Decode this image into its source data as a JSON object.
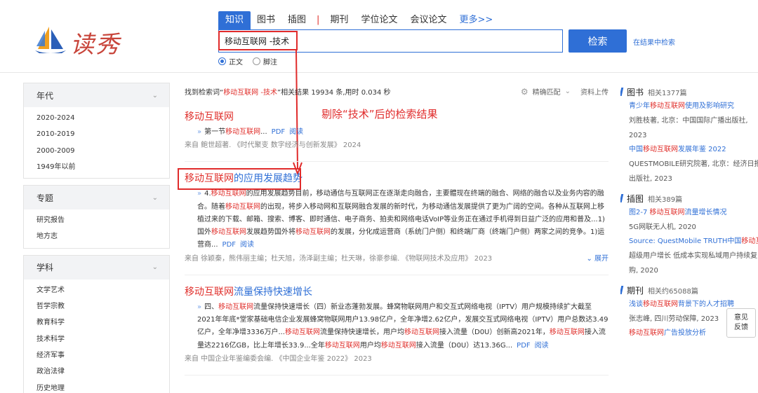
{
  "header": {
    "logo_text": "读秀",
    "tabs": [
      "知识",
      "图书",
      "插图",
      "|",
      "期刊",
      "学位论文",
      "会议论文",
      "更多>>"
    ],
    "search_value": "移动互联网 -技术",
    "search_button": "检索",
    "search_within": "在结果中检索",
    "radio_options": [
      "正文",
      "脚注"
    ]
  },
  "annotation": "剔除“技术”后的检索结果",
  "left": {
    "facets": [
      {
        "title": "年代",
        "items": [
          "2020-2024",
          "2010-2019",
          "2000-2009",
          "1949年以前"
        ]
      },
      {
        "title": "专题",
        "items": [
          "研究报告",
          "地方志"
        ]
      },
      {
        "title": "学科",
        "items": [
          "文学艺术",
          "哲学宗教",
          "教育科学",
          "技术科学",
          "经济军事",
          "政治法律",
          "历史地理"
        ]
      }
    ]
  },
  "main": {
    "summary_pre": "找到检索词“",
    "summary_term": "移动互联网 -技术",
    "summary_post": "”相关结果 19934 条,用时 0.034 秒",
    "precise_match": "精确匹配",
    "upload": "资料上传",
    "results": [
      {
        "title_hl": "移动互联网",
        "title_rest": "",
        "snippet_parts": [
          {
            "t": "第一节",
            "hl": false
          },
          {
            "t": "移动互联网",
            "hl": true
          },
          {
            "t": "...",
            "hl": false
          }
        ],
        "pdf": "PDF",
        "read": "阅读",
        "source": "来自 鲍世超著. 《时代聚变 数字经济与创新发展》 2024",
        "expand": ""
      },
      {
        "title_hl": "移动互联网",
        "title_rest": "的应用发展趋势",
        "snippet_parts": [
          {
            "t": "4.",
            "hl": false
          },
          {
            "t": "移动互联网",
            "hl": true
          },
          {
            "t": "的应用发展趋势目前，移动通信与互联网正在逐渐走向融合，主要體现在终端的融合、网络的融合以及业务内容的融合。随着",
            "hl": false
          },
          {
            "t": "移动互联网",
            "hl": true
          },
          {
            "t": "的出现，将步入移动网和互联网融合发展的新时代，为移动通信发展提供了更为广阔的空间。各种从互联网上移植过来的下载、邮箱、搜索、博客、即时通信、电子商务、拍卖和网络电话VoIP等业务正在通过手机得到日益广泛的应用和普及...1)国外",
            "hl": false
          },
          {
            "t": "移动互联网",
            "hl": true
          },
          {
            "t": "发展趋势国外将",
            "hl": false
          },
          {
            "t": "移动互联网",
            "hl": true
          },
          {
            "t": "的发展，分化成运营商（系统门户侧）和终端厂商（终端门户侧）两家之间的竞争。1)运营商...",
            "hl": false
          }
        ],
        "pdf": "PDF",
        "read": "阅读",
        "source": "来自 徐颖秦，熊伟丽主编；杜天旭，汤泽副主编；杜天琳，徐豪参编. 《物联网技术及应用》 2023",
        "expand": "展开"
      },
      {
        "title_hl": "移动互联网",
        "title_rest": "流量保持快速增长",
        "snippet_parts": [
          {
            "t": "四、",
            "hl": false
          },
          {
            "t": "移动互联网",
            "hl": true
          },
          {
            "t": "流量保持快速增长（四）新业态蓬勃发展。蜂窝物联网用户和交互式网络电视（IPTV）用户规模持续扩大截至2021年年底*堂家基础电信企业发展蜂窝物联网用户13.98亿户，全年净增2.62亿户，发展交互式网络电视（IPTV）用户总数达3.49亿户，全年净增3336万户...",
            "hl": false
          },
          {
            "t": "移动互联网",
            "hl": true
          },
          {
            "t": "流量保持快速增长，用户均",
            "hl": false
          },
          {
            "t": "移动互联网",
            "hl": true
          },
          {
            "t": "接入流量（D0U）创新高2021年，",
            "hl": false
          },
          {
            "t": "移动互联网",
            "hl": true
          },
          {
            "t": "接入流量达2216亿GB，比上年增长33.9...全年",
            "hl": false
          },
          {
            "t": "移动互联网",
            "hl": true
          },
          {
            "t": "用户均",
            "hl": false
          },
          {
            "t": "移动互联网",
            "hl": true
          },
          {
            "t": "接入流量（D0U）达13.36G...",
            "hl": false
          }
        ],
        "pdf": "PDF",
        "read": "阅读",
        "source": "来自 中国企业年鉴编委会编. 《中国企业年鉴 2022》 2023",
        "expand": ""
      }
    ]
  },
  "right": {
    "sections": [
      {
        "title": "图书",
        "count": "相关1377篇",
        "items": [
          {
            "parts": [
              {
                "t": "青少年",
                "hl": false
              },
              {
                "t": "移动互联网",
                "hl": true
              },
              {
                "t": "使用及影响研究",
                "hl": false
              }
            ],
            "meta": [
              "刘胜枝著, 北京：中国国际广播出版社, 2023"
            ]
          },
          {
            "parts": [
              {
                "t": "中国",
                "hl": false
              },
              {
                "t": "移动互联网",
                "hl": true
              },
              {
                "t": "发展年鉴 2022",
                "hl": false
              }
            ],
            "meta": [
              "QUESTMOBILE研究院著, 北京：经济日报出版社, 2023"
            ]
          }
        ]
      },
      {
        "title": "插图",
        "count": "相关389篇",
        "items": [
          {
            "parts": [
              {
                "t": "图2-7 ",
                "hl": false
              },
              {
                "t": "移动互联网",
                "hl": true
              },
              {
                "t": "流量增长情况",
                "hl": false
              }
            ],
            "meta": [
              "5G网联无人机, 2020"
            ]
          },
          {
            "parts": [
              {
                "t": "Source: QuestMobile TRUTH中国",
                "hl": false
              },
              {
                "t": "移动互联网",
                "hl": true
              },
              {
                "t": "数据库2019年6月",
                "hl": false
              }
            ],
            "meta": [
              "超级用户增长 低成本实现私域用户持续复购, 2020"
            ]
          }
        ]
      },
      {
        "title": "期刊",
        "count": "相关约65088篇",
        "items": [
          {
            "parts": [
              {
                "t": "浅谈",
                "hl": false
              },
              {
                "t": "移动互联网",
                "hl": true
              },
              {
                "t": "背景下的人才招聘",
                "hl": false
              }
            ],
            "meta": [
              "张志峰, 四川劳动保障, 2023"
            ]
          },
          {
            "parts": [
              {
                "t": "移动互联网",
                "hl": true
              },
              {
                "t": "广告投放分析",
                "hl": false
              }
            ],
            "meta": []
          }
        ]
      }
    ]
  },
  "feedback": [
    "意见",
    "反馈"
  ]
}
